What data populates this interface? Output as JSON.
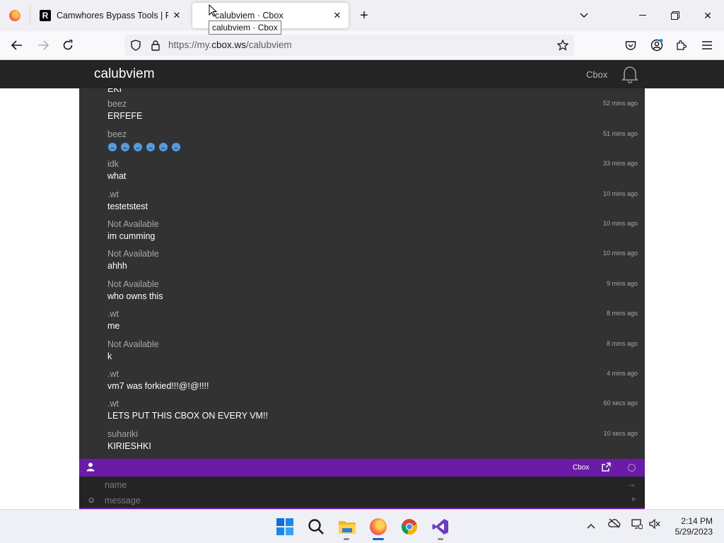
{
  "browser": {
    "tabs": [
      {
        "title": "Camwhores Bypass Tools | Priva",
        "favicon": "R"
      },
      {
        "title": "calubviem · Cbox",
        "active": true
      }
    ],
    "tooltip": "calubviem · Cbox",
    "url_prefix": "https://my.",
    "url_domain": "cbox.ws",
    "url_path": "/calubviem",
    "accent_color": "#ff7139"
  },
  "cbox": {
    "box_name": "calubviem",
    "header_link": "Cbox",
    "messages": [
      {
        "name": "beez",
        "text": "ERFEFE",
        "time": "52 mins ago"
      },
      {
        "name": "beez",
        "text": "",
        "time": "51 mins ago",
        "emoji_count": 6,
        "emoji": "worried-face-emoji"
      },
      {
        "name": "idk",
        "text": "what",
        "time": "33 mins ago"
      },
      {
        "name": ".wt",
        "text": "testetstest",
        "time": "10 mins ago"
      },
      {
        "name": "Not Available",
        "text": "im cumming",
        "time": "10 mins ago"
      },
      {
        "name": "Not Available",
        "text": "ahhh",
        "time": "10 mins ago"
      },
      {
        "name": "Not Available",
        "text": "who owns this",
        "time": "9 mins ago"
      },
      {
        "name": ".wt",
        "text": "me",
        "time": "8 mins ago"
      },
      {
        "name": "Not Available",
        "text": "k",
        "time": "8 mins ago"
      },
      {
        "name": ".wt",
        "text": "vm7 was forkied!!!@!@!!!!",
        "time": "4 mins ago"
      },
      {
        "name": ".wt",
        "text": "LETS PUT THIS CBOX ON EVERY VM!!",
        "time": "60 secs ago"
      },
      {
        "name": "suhariki",
        "text": "KIRIESHKI",
        "time": "10 secs ago"
      }
    ],
    "partial_top_text": "EKI",
    "toolbar_label": "Cbox",
    "name_placeholder": "name",
    "message_placeholder": "message",
    "toolbar_color": "#6b1ba8"
  },
  "taskbar": {
    "time": "2:14 PM",
    "date": "5/29/2023"
  }
}
